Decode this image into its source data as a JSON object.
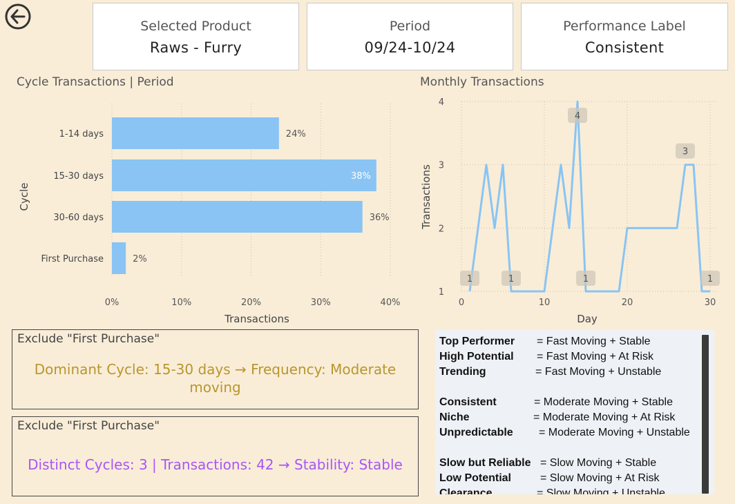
{
  "cards": [
    {
      "label": "Selected Product",
      "value": "Raws - Furry"
    },
    {
      "label": "Period",
      "value": "09/24-10/24"
    },
    {
      "label": "Performance Label",
      "value": "Consistent"
    }
  ],
  "bar_chart": {
    "title": "Cycle Transactions | Period"
  },
  "line_chart": {
    "title": "Monthly Transactions"
  },
  "chart_data": [
    {
      "type": "bar",
      "orientation": "horizontal",
      "title": "Cycle Transactions | Period",
      "categories": [
        "1-14 days",
        "15-30 days",
        "30-60 days",
        "First Purchase"
      ],
      "values": [
        24,
        38,
        36,
        2
      ],
      "data_labels": [
        "24%",
        "38%",
        "36%",
        "2%"
      ],
      "xlabel": "Transactions",
      "ylabel": "Cycle",
      "xlim": [
        0,
        40
      ],
      "x_ticks": [
        "0%",
        "10%",
        "20%",
        "30%",
        "40%"
      ],
      "bar_color": "#89c4f4",
      "grid": true
    },
    {
      "type": "line",
      "title": "Monthly Transactions",
      "xlabel": "Day",
      "ylabel": "Transactions",
      "xlim": [
        0,
        31
      ],
      "ylim": [
        1,
        4
      ],
      "x_ticks": [
        "0",
        "10",
        "20",
        "30"
      ],
      "y_ticks": [
        "1",
        "2",
        "3",
        "4"
      ],
      "x": [
        1,
        3,
        4,
        5,
        6,
        8,
        9,
        10,
        11,
        12,
        13,
        14,
        15,
        16,
        17,
        18,
        19,
        20,
        21,
        22,
        23,
        24,
        25,
        26,
        27,
        28,
        29,
        30
      ],
      "y": [
        1,
        3,
        2,
        3,
        1,
        1,
        1,
        1,
        2,
        3,
        2,
        4,
        1,
        1,
        1,
        1,
        1,
        2,
        2,
        2,
        2,
        2,
        2,
        2,
        3,
        3,
        1,
        1
      ],
      "annotations": [
        {
          "x": 1,
          "y": 1,
          "label": "1"
        },
        {
          "x": 6,
          "y": 1,
          "label": "1"
        },
        {
          "x": 14,
          "y": 4,
          "label": "4"
        },
        {
          "x": 15,
          "y": 1,
          "label": "1"
        },
        {
          "x": 27,
          "y": 3,
          "label": "3"
        },
        {
          "x": 30,
          "y": 1,
          "label": "1"
        }
      ],
      "line_color": "#89c4f4",
      "grid": true
    }
  ],
  "notes": [
    {
      "title": "Exclude \"First Purchase\"",
      "message": "Dominant Cycle: 15-30 days → Frequency: Moderate moving",
      "color": "#b8962e"
    },
    {
      "title": "Exclude \"First Purchase\"",
      "message": "Distinct Cycles: 3 | Transactions: 42 → Stability: Stable",
      "color": "#a855f7"
    }
  ],
  "legend": [
    {
      "label": "Top Performer",
      "definition": "= Fast Moving + Stable"
    },
    {
      "label": "High Potential",
      "definition": "= Fast Moving + At Risk"
    },
    {
      "label": "Trending",
      "definition": "= Fast Moving + Unstable"
    },
    {
      "label": "Consistent",
      "definition": "= Moderate Moving + Stable"
    },
    {
      "label": "Niche",
      "definition": "= Moderate Moving + At Risk"
    },
    {
      "label": "Unpredictable",
      "definition": "= Moderate Moving + Unstable"
    },
    {
      "label": "Slow but Reliable",
      "definition": "= Slow Moving + Stable"
    },
    {
      "label": "Low Potential",
      "definition": "= Slow Moving + At Risk"
    },
    {
      "label": "Clearance",
      "definition": "= Slow Moving + Unstable"
    }
  ]
}
